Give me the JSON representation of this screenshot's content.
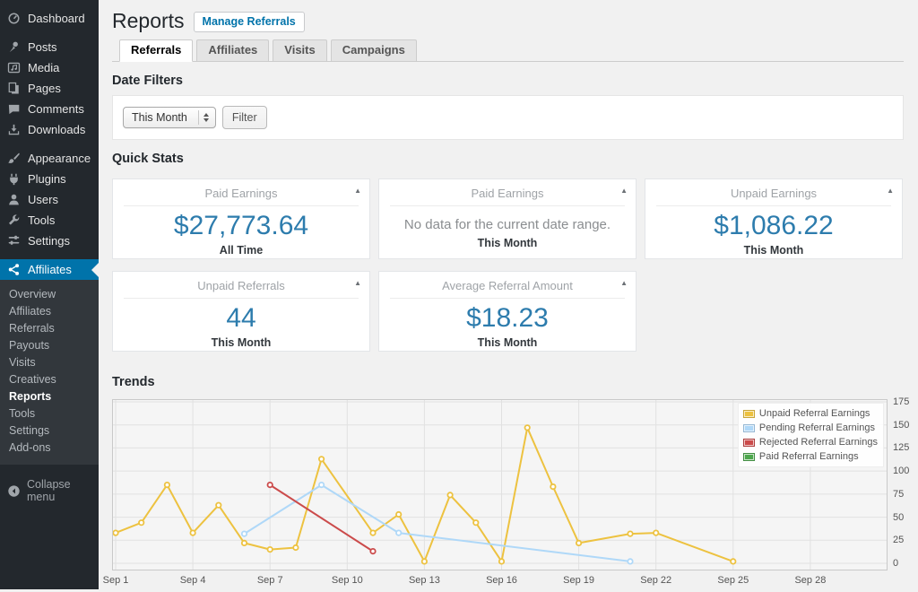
{
  "sidebar": {
    "items": [
      {
        "label": "Dashboard",
        "icon": "dashboard-icon",
        "separator_before": false,
        "active": false
      },
      {
        "label": "Posts",
        "icon": "pin-icon",
        "separator_before": true,
        "active": false
      },
      {
        "label": "Media",
        "icon": "media-icon",
        "separator_before": false,
        "active": false
      },
      {
        "label": "Pages",
        "icon": "pages-icon",
        "separator_before": false,
        "active": false
      },
      {
        "label": "Comments",
        "icon": "comments-icon",
        "separator_before": false,
        "active": false
      },
      {
        "label": "Downloads",
        "icon": "downloads-icon",
        "separator_before": false,
        "active": false
      },
      {
        "label": "Appearance",
        "icon": "appearance-icon",
        "separator_before": true,
        "active": false
      },
      {
        "label": "Plugins",
        "icon": "plugins-icon",
        "separator_before": false,
        "active": false
      },
      {
        "label": "Users",
        "icon": "users-icon",
        "separator_before": false,
        "active": false
      },
      {
        "label": "Tools",
        "icon": "tools-icon",
        "separator_before": false,
        "active": false
      },
      {
        "label": "Settings",
        "icon": "settings-icon",
        "separator_before": false,
        "active": false
      },
      {
        "label": "Affiliates",
        "icon": "affiliates-icon",
        "separator_before": true,
        "active": true
      }
    ],
    "submenu": {
      "items": [
        "Overview",
        "Affiliates",
        "Referrals",
        "Payouts",
        "Visits",
        "Creatives",
        "Reports",
        "Tools",
        "Settings",
        "Add-ons"
      ],
      "active": "Reports"
    },
    "collapse_label": "Collapse menu"
  },
  "header": {
    "title": "Reports",
    "action_button": "Manage Referrals"
  },
  "tabs": [
    {
      "label": "Referrals",
      "active": true
    },
    {
      "label": "Affiliates",
      "active": false
    },
    {
      "label": "Visits",
      "active": false
    },
    {
      "label": "Campaigns",
      "active": false
    }
  ],
  "date_filters": {
    "heading": "Date Filters",
    "select_value": "This Month",
    "filter_button": "Filter"
  },
  "quick_stats": {
    "heading": "Quick Stats",
    "cards": [
      {
        "title": "Paid Earnings",
        "value": "$27,773.64",
        "message": "",
        "period": "All Time"
      },
      {
        "title": "Paid Earnings",
        "value": "",
        "message": "No data for the current date range.",
        "period": "This Month"
      },
      {
        "title": "Unpaid Earnings",
        "value": "$1,086.22",
        "message": "",
        "period": "This Month"
      },
      {
        "title": "Unpaid Referrals",
        "value": "44",
        "message": "",
        "period": "This Month"
      },
      {
        "title": "Average Referral Amount",
        "value": "$18.23",
        "message": "",
        "period": "This Month"
      }
    ]
  },
  "trends": {
    "heading": "Trends"
  },
  "chart_data": {
    "type": "line",
    "title": "Trends",
    "xlabel": "",
    "ylabel": "",
    "ylim": [
      0,
      175
    ],
    "yticks": [
      0,
      25,
      50,
      75,
      100,
      125,
      150,
      175
    ],
    "x_axis_unit": "day of September",
    "x_range_days": [
      1,
      31
    ],
    "x_ticks": [
      {
        "day": 1,
        "label": "Sep 1"
      },
      {
        "day": 4,
        "label": "Sep 4"
      },
      {
        "day": 7,
        "label": "Sep 7"
      },
      {
        "day": 10,
        "label": "Sep 10"
      },
      {
        "day": 13,
        "label": "Sep 13"
      },
      {
        "day": 16,
        "label": "Sep 16"
      },
      {
        "day": 19,
        "label": "Sep 19"
      },
      {
        "day": 22,
        "label": "Sep 22"
      },
      {
        "day": 25,
        "label": "Sep 25"
      },
      {
        "day": 28,
        "label": "Sep 28"
      }
    ],
    "grid": true,
    "legend_position": "top-right",
    "series": [
      {
        "name": "Unpaid Referral Earnings",
        "color": "#edc240",
        "points": [
          [
            1,
            33
          ],
          [
            2,
            44
          ],
          [
            3,
            85
          ],
          [
            4,
            33
          ],
          [
            5,
            63
          ],
          [
            6,
            22
          ],
          [
            7,
            15
          ],
          [
            8,
            17
          ],
          [
            9,
            113
          ],
          [
            11,
            33
          ],
          [
            12,
            53
          ],
          [
            13,
            2
          ],
          [
            14,
            74
          ],
          [
            15,
            44
          ],
          [
            16,
            2
          ],
          [
            17,
            147
          ],
          [
            18,
            83
          ],
          [
            19,
            22
          ],
          [
            21,
            32
          ],
          [
            22,
            33
          ],
          [
            25,
            2
          ]
        ]
      },
      {
        "name": "Pending Referral Earnings",
        "color": "#afd8f8",
        "points": [
          [
            6,
            32
          ],
          [
            9,
            85
          ],
          [
            12,
            33
          ],
          [
            21,
            2
          ]
        ]
      },
      {
        "name": "Rejected Referral Earnings",
        "color": "#cb4b4b",
        "points": [
          [
            7,
            85
          ],
          [
            11,
            13
          ]
        ]
      },
      {
        "name": "Paid Referral Earnings",
        "color": "#4da74d",
        "points": []
      }
    ]
  },
  "colors": {
    "sidebar_bg": "#23282d",
    "submenu_bg": "#32373c",
    "active_menu_bg": "#0073aa",
    "link_blue": "#0073aa",
    "stat_value_blue": "#2d7cad",
    "page_bg": "#f1f1f1"
  }
}
